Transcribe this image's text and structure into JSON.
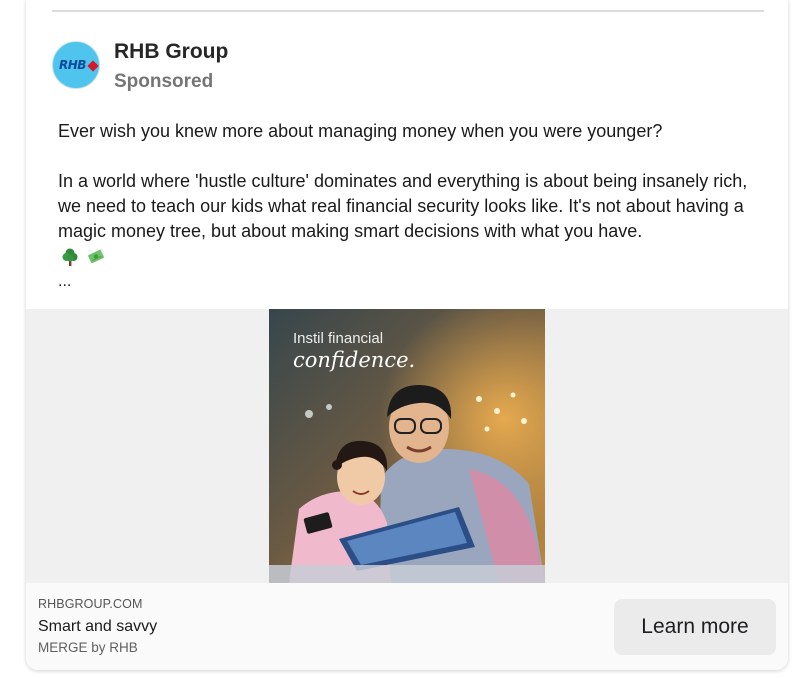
{
  "post": {
    "page_name": "RHB Group",
    "sponsored_label": "Sponsored",
    "avatar_text": "RHB",
    "body_paragraph_1": "Ever wish you knew more about managing money when you were younger?",
    "body_paragraph_2": "In a world where 'hustle culture' dominates and everything is about being insanely rich, we need to teach our kids what real financial security looks like. It's not about having a magic money tree, but about making smart decisions with what you have.",
    "emojis": [
      "tree-icon",
      "money-with-wings-icon"
    ],
    "see_more": "..."
  },
  "ad_image": {
    "headline_line_1": "Instil financial",
    "headline_line_2": "confidence."
  },
  "link_footer": {
    "domain": "RHBGROUP.COM",
    "headline": "Smart and savvy",
    "description": "MERGE by RHB",
    "cta_label": "Learn more"
  },
  "colors": {
    "avatar_bg": "#4fc4ec",
    "avatar_text": "#0b4a9c",
    "brand_red": "#d6162a",
    "cta_bg": "#ebebeb",
    "media_bg": "#f0f0f0"
  }
}
